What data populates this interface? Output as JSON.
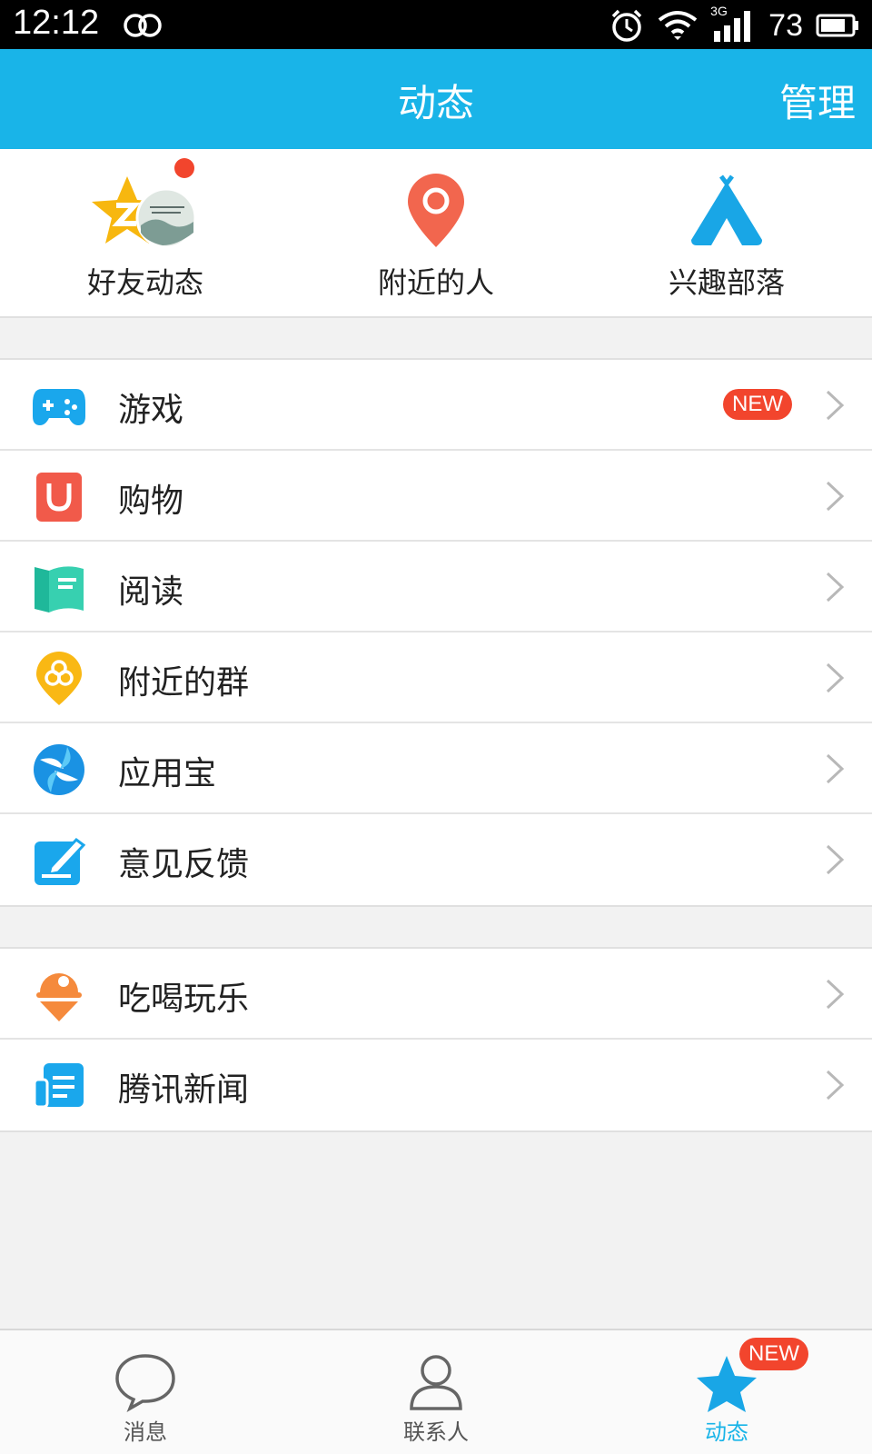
{
  "status_bar": {
    "time": "12:12",
    "battery": "73",
    "network": "3G"
  },
  "header": {
    "title": "动态",
    "action": "管理"
  },
  "shortcuts": [
    {
      "label": "好友动态",
      "icon": "qzone-star-icon"
    },
    {
      "label": "附近的人",
      "icon": "location-pin-icon"
    },
    {
      "label": "兴趣部落",
      "icon": "tent-icon"
    }
  ],
  "menu_group_1": [
    {
      "label": "游戏",
      "icon": "gamepad-icon",
      "badge": "NEW"
    },
    {
      "label": "购物",
      "icon": "shopping-bag-icon"
    },
    {
      "label": "阅读",
      "icon": "book-icon"
    },
    {
      "label": "附近的群",
      "icon": "nearby-group-icon"
    },
    {
      "label": "应用宝",
      "icon": "app-store-icon"
    },
    {
      "label": "意见反馈",
      "icon": "feedback-icon"
    }
  ],
  "menu_group_2": [
    {
      "label": "吃喝玩乐",
      "icon": "ice-cream-icon"
    },
    {
      "label": "腾讯新闻",
      "icon": "news-icon"
    }
  ],
  "tabbar": [
    {
      "label": "消息",
      "icon": "chat-bubble-icon"
    },
    {
      "label": "联系人",
      "icon": "contacts-icon"
    },
    {
      "label": "动态",
      "icon": "star-icon",
      "badge": "NEW",
      "active": true
    }
  ],
  "colors": {
    "primary": "#19b4e8",
    "badge": "#f2452d"
  }
}
